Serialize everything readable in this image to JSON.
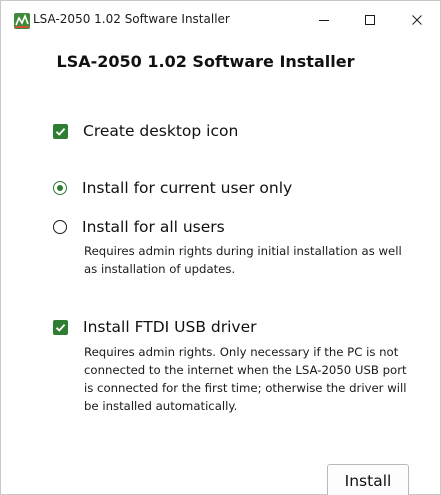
{
  "window": {
    "title": "LSA-2050 1.02 Software Installer",
    "icon": "app-installer-icon",
    "controls": [
      "minimize-icon",
      "maximize-icon",
      "close-icon"
    ]
  },
  "heading": "LSA-2050 1.02 Software Installer",
  "options": {
    "desktop_icon": {
      "label": "Create desktop icon",
      "checked": true
    },
    "current_user": {
      "label": "Install for current user only",
      "selected": true
    },
    "all_users": {
      "label": "Install for all users",
      "selected": false,
      "description": "Requires admin rights during initial installation as well as installation of updates."
    },
    "ftdi": {
      "label": "Install FTDI USB driver",
      "checked": true,
      "description": "Requires admin rights. Only necessary if the PC is not connected to the internet when the LSA-2050 USB port is connected for the first time; otherwise the driver will be installed automatically."
    }
  },
  "buttons": {
    "install": "Install"
  },
  "colors": {
    "accent": "#2e7d32",
    "background": "#ffffff",
    "text": "#111111"
  }
}
